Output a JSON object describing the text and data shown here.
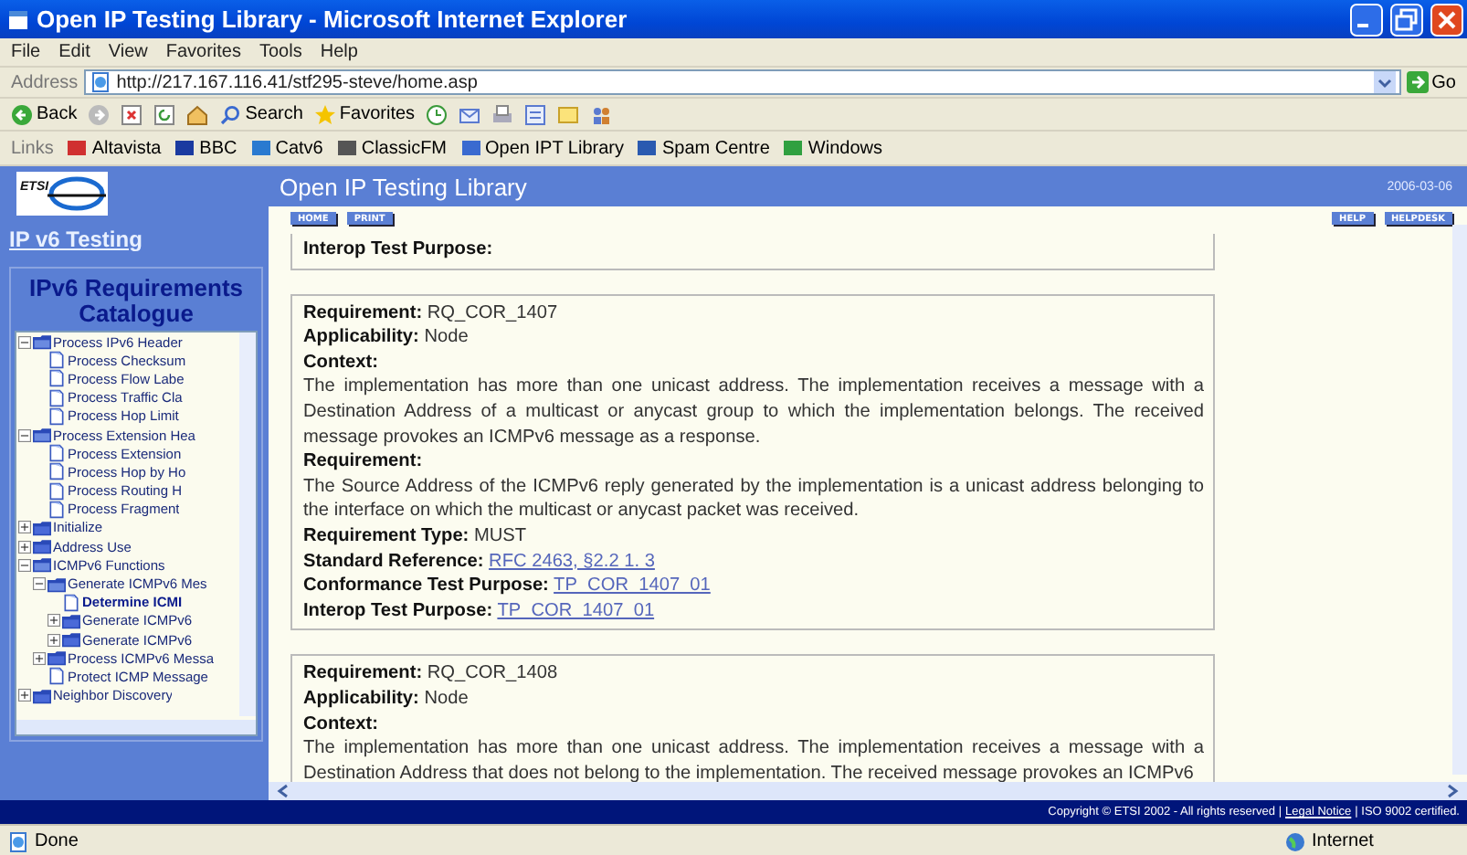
{
  "window": {
    "title": "Open IP Testing Library - Microsoft Internet Explorer"
  },
  "menu": [
    "File",
    "Edit",
    "View",
    "Favorites",
    "Tools",
    "Help"
  ],
  "address": {
    "label": "Address",
    "value": "http://217.167.116.41/stf295-steve/home.asp",
    "go": "Go"
  },
  "toolbar": {
    "back": "Back",
    "search": "Search",
    "favorites": "Favorites"
  },
  "links": {
    "label": "Links",
    "items": [
      "Altavista",
      "BBC",
      "Catv6",
      "ClassicFM",
      "Open IPT Library",
      "Spam Centre",
      "Windows"
    ]
  },
  "sidebar": {
    "logo": "ETSI",
    "home_link": "IP v6 Testing",
    "catalogue_title": "IPv6 Requirements Catalogue",
    "tree": [
      {
        "label": "Process IPv6 Header",
        "kind": "folder",
        "expanded": true,
        "selected": false,
        "children": [
          {
            "label": "Process Checksum",
            "kind": "document",
            "selected": false
          },
          {
            "label": "Process Flow Labe",
            "kind": "document",
            "selected": false
          },
          {
            "label": "Process Traffic Cla",
            "kind": "document",
            "selected": false
          },
          {
            "label": "Process Hop Limit",
            "kind": "document",
            "selected": false
          }
        ]
      },
      {
        "label": "Process Extension Hea",
        "kind": "folder",
        "expanded": true,
        "selected": false,
        "children": [
          {
            "label": "Process Extension",
            "kind": "document",
            "selected": false
          },
          {
            "label": "Process Hop by Ho",
            "kind": "document",
            "selected": false
          },
          {
            "label": "Process Routing H",
            "kind": "document",
            "selected": false
          },
          {
            "label": "Process Fragment",
            "kind": "document",
            "selected": false
          }
        ]
      },
      {
        "label": "Initialize",
        "kind": "folder",
        "expanded": false,
        "selected": false
      },
      {
        "label": "Address Use",
        "kind": "folder",
        "expanded": false,
        "selected": false
      },
      {
        "label": "ICMPv6 Functions",
        "kind": "folder",
        "expanded": true,
        "selected": false,
        "children": [
          {
            "label": "Generate ICMPv6 Mes",
            "kind": "folder",
            "expanded": true,
            "selected": false,
            "children": [
              {
                "label": "Determine ICMI",
                "kind": "document",
                "selected": true
              },
              {
                "label": "Generate ICMPv6",
                "kind": "folder",
                "expanded": false,
                "selected": false
              },
              {
                "label": "Generate ICMPv6",
                "kind": "folder",
                "expanded": false,
                "selected": false
              }
            ]
          },
          {
            "label": "Process ICMPv6 Messa",
            "kind": "folder",
            "expanded": false,
            "selected": false
          },
          {
            "label": "Protect ICMP Message",
            "kind": "document",
            "selected": false
          }
        ]
      },
      {
        "label": "Neighbor Discovery",
        "kind": "folder",
        "expanded": false,
        "selected": false
      }
    ]
  },
  "header": {
    "title": "Open IP Testing Library",
    "date": "2006-03-06"
  },
  "buttons_left": [
    "HOME",
    "PRINT"
  ],
  "buttons_right": [
    "HELP",
    "HELPDESK"
  ],
  "cards": [
    {
      "kind": "partial-top",
      "fields": [
        {
          "label": "Interop Test Purpose:",
          "kind": "inline"
        }
      ]
    },
    {
      "kind": "full",
      "fields": [
        {
          "label": "Requirement:",
          "value": "RQ_COR_1407",
          "kind": "inline"
        },
        {
          "label": "Applicability:",
          "value": "Node",
          "kind": "inline"
        },
        {
          "label": "Context:",
          "value": "The implementation has more than one unicast address. The implementation receives a message with a Destination Address of a multicast or anycast group to which the implementation belongs. The received message provokes an ICMPv6 message as a response.",
          "kind": "block"
        },
        {
          "label": "Requirement:",
          "value": "The Source Address of the ICMPv6 reply generated by the implementation is a unicast address belonging to the interface on which the multicast or anycast packet was received.",
          "kind": "block"
        },
        {
          "label": "Requirement Type:",
          "value": "MUST",
          "kind": "inline"
        },
        {
          "label": "Standard Reference:",
          "value": "RFC 2463, §2.2 1. 3",
          "kind": "link"
        },
        {
          "label": "Conformance Test Purpose:",
          "value": "TP_COR_1407_01",
          "kind": "link"
        },
        {
          "label": "Interop Test Purpose:",
          "value": "TP_COR_1407_01",
          "kind": "link"
        }
      ]
    },
    {
      "kind": "partial-bottom",
      "fields": [
        {
          "label": "Requirement:",
          "value": "RQ_COR_1408",
          "kind": "inline"
        },
        {
          "label": "Applicability:",
          "value": "Node",
          "kind": "inline"
        },
        {
          "label": "Context:",
          "value": "The implementation has more than one unicast address. The implementation receives a message with a Destination Address that does not belong to the implementation. The received message provokes an ICMPv6",
          "kind": "block"
        }
      ]
    }
  ],
  "footer": {
    "copyright": "Copyright © ETSI 2002 - All rights reserved |",
    "legal": "Legal Notice",
    "iso": "| ISO 9002 certified."
  },
  "status_bar": {
    "text": "Done",
    "zone": "Internet"
  }
}
